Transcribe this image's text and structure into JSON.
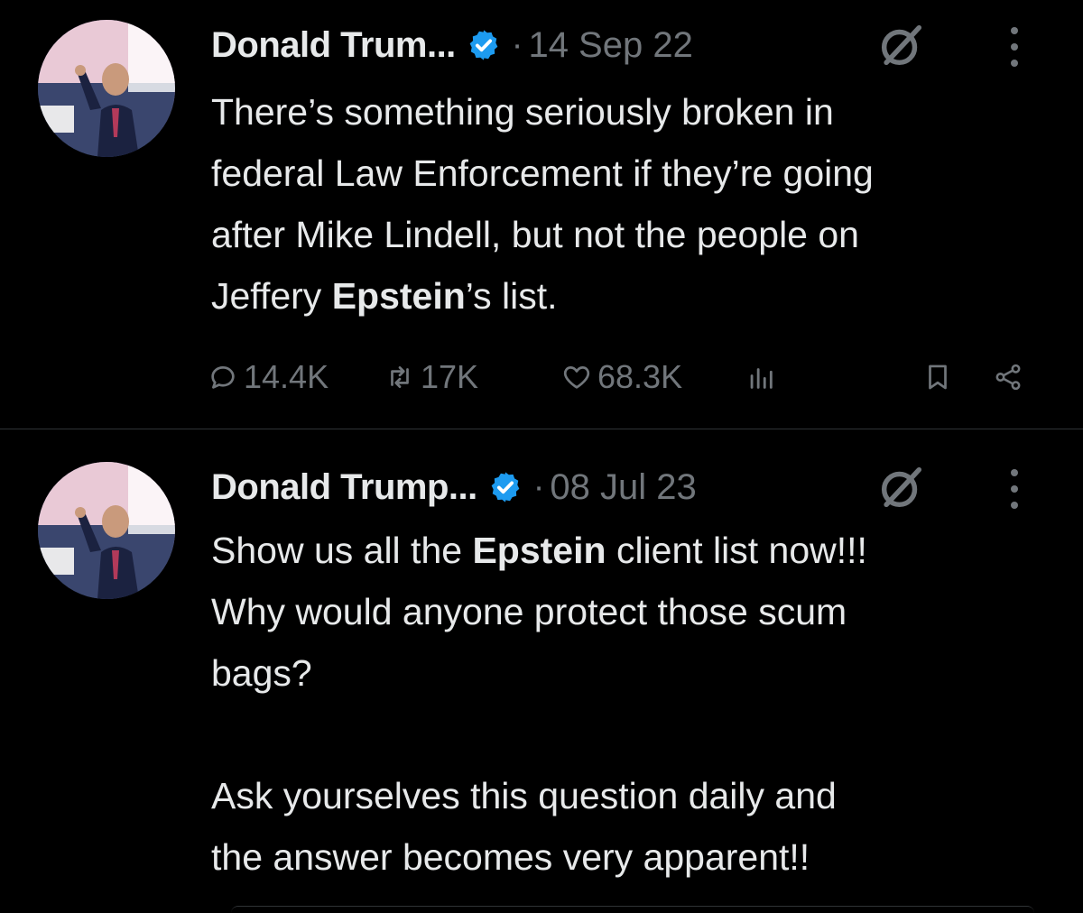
{
  "tweets": [
    {
      "author": "Donald Trum...",
      "separator": "·",
      "date": "14 Sep 22",
      "text_lines": [
        "There’s something seriously broken in",
        "federal Law Enforcement if they’re going",
        "after Mike Lindell, but not the people on"
      ],
      "text_last_prefix": "Jeffery ",
      "text_last_bold": "Epstein",
      "text_last_suffix": "’s list.",
      "reply_count": "14.4K",
      "retweet_count": "17K",
      "like_count": "68.3K"
    },
    {
      "author": "Donald Trump...",
      "separator": "·",
      "date": "08 Jul 23",
      "line1_prefix": "Show us all the ",
      "line1_bold": "Epstein",
      "line1_suffix": " client list now!!!",
      "lines": [
        "Why would anyone protect those scum",
        "bags?"
      ],
      "paragraph2": [
        "Ask yourselves this question daily and",
        "the answer becomes very apparent!!"
      ]
    }
  ],
  "icons": {
    "verified": "verified-badge-icon",
    "grok": "grok-icon",
    "more": "more-vertical-icon",
    "reply": "reply-icon",
    "retweet": "retweet-icon",
    "like": "heart-icon",
    "views": "views-icon",
    "bookmark": "bookmark-icon",
    "share": "share-icon"
  },
  "colors": {
    "background": "#000000",
    "text": "#e7e9ea",
    "muted": "#71767b",
    "verified": "#1d9bf0",
    "divider": "#2f3336"
  }
}
